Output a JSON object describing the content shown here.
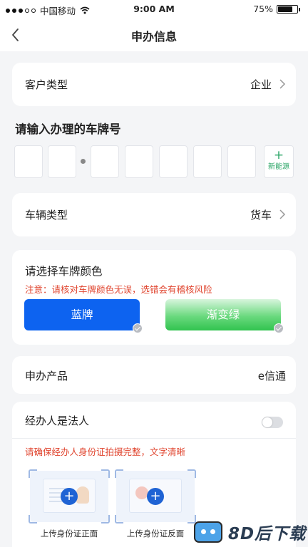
{
  "status_bar": {
    "carrier": "中国移动",
    "time": "9:00 AM",
    "battery": "75%",
    "battery_level": 0.75
  },
  "nav": {
    "title": "申办信息",
    "back_icon": "chevron-left-icon"
  },
  "customer_type": {
    "label": "客户类型",
    "value": "企业"
  },
  "plate_input": {
    "title": "请输入办理的车牌号",
    "new_energy_plus": "+",
    "new_energy_label": "新能源"
  },
  "vehicle_type": {
    "label": "车辆类型",
    "value": "货车"
  },
  "plate_color": {
    "title": "请选择车牌颜色",
    "warning": "注意：请核对车牌颜色无误，选错会有稽核风险",
    "options": [
      {
        "label": "蓝牌",
        "color": "#0d63f0"
      },
      {
        "label": "渐变绿",
        "color": "#31c34f"
      }
    ]
  },
  "product": {
    "label": "申办产品",
    "value": "e信通"
  },
  "agent": {
    "label": "经办人是法人",
    "toggle_on": false,
    "warning": "请确保经办人身份证拍摄完整，文字清晰",
    "uploads": [
      {
        "label": "上传身份证正面"
      },
      {
        "label": "上传身份证反面"
      }
    ]
  },
  "watermark": {
    "text": "8D后下载"
  },
  "colors": {
    "accent_blue": "#0d63f0",
    "accent_green": "#2aa566",
    "warning_red": "#e0452f",
    "background": "#f4f5f7"
  }
}
